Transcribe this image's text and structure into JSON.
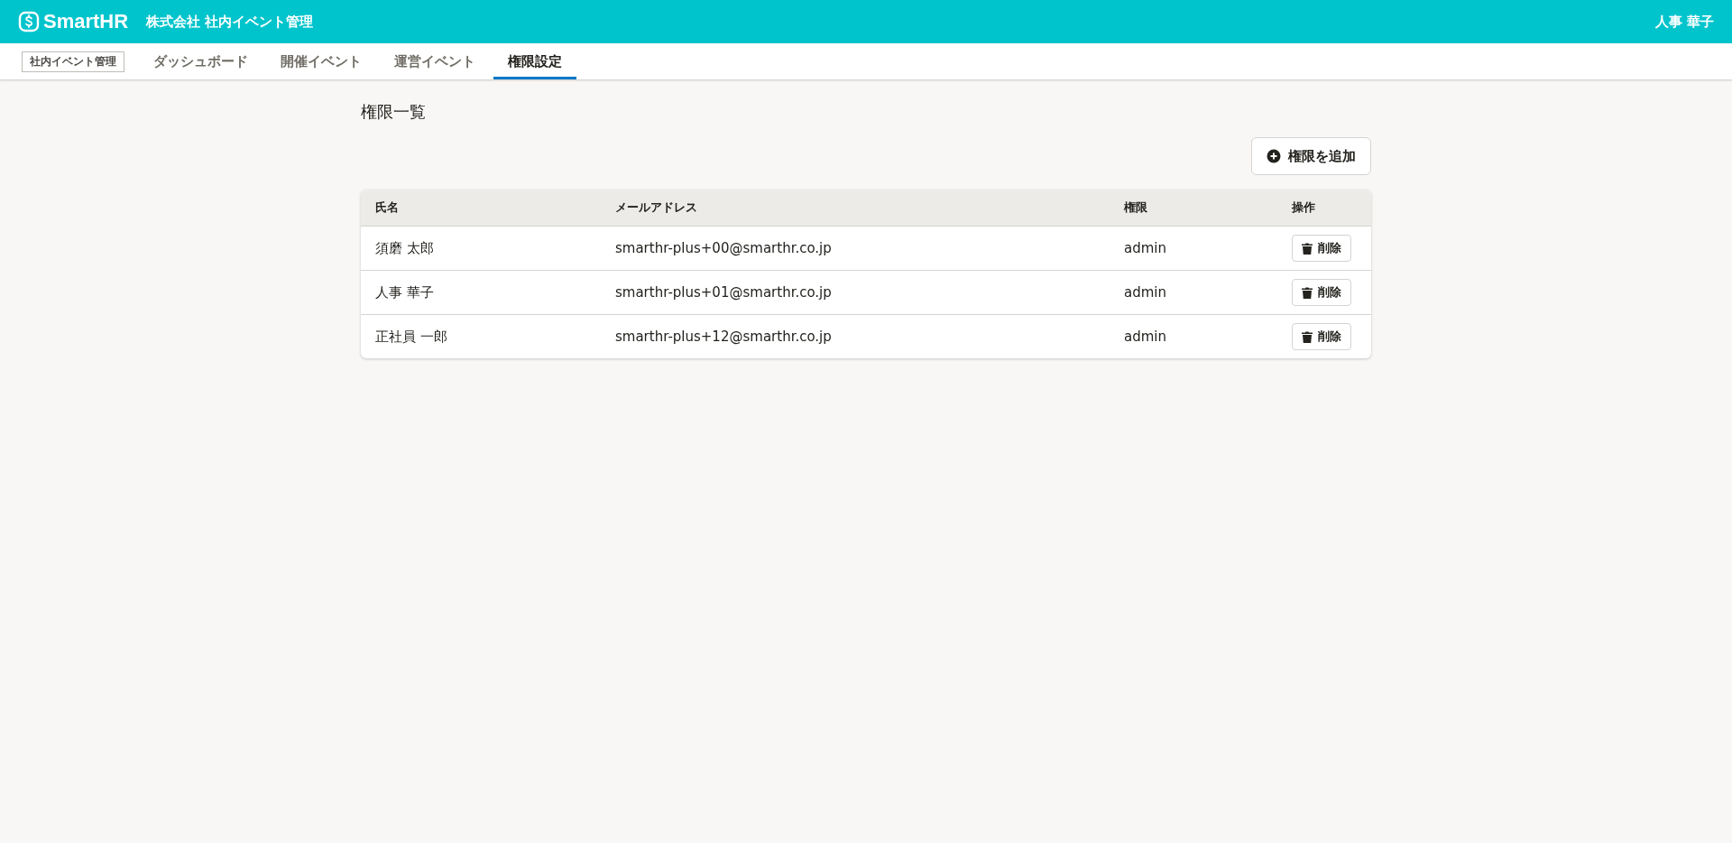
{
  "header": {
    "logo": "SmartHR",
    "company": "株式会社 社内イベント管理",
    "user": "人事 華子"
  },
  "nav": {
    "app_label": "社内イベント管理",
    "tabs": [
      {
        "label": "ダッシュボード",
        "selected": false
      },
      {
        "label": "開催イベント",
        "selected": false
      },
      {
        "label": "運営イベント",
        "selected": false
      },
      {
        "label": "権限設定",
        "selected": true
      }
    ]
  },
  "page": {
    "title": "権限一覧",
    "add_button": "権限を追加"
  },
  "table": {
    "columns": [
      "氏名",
      "メールアドレス",
      "権限",
      "操作"
    ],
    "rows": [
      {
        "name": "須磨 太郎",
        "email": "smarthr-plus+00@smarthr.co.jp",
        "role": "admin",
        "action": "削除"
      },
      {
        "name": "人事 華子",
        "email": "smarthr-plus+01@smarthr.co.jp",
        "role": "admin",
        "action": "削除"
      },
      {
        "name": "正社員 一郎",
        "email": "smarthr-plus+12@smarthr.co.jp",
        "role": "admin",
        "action": "削除"
      }
    ]
  }
}
